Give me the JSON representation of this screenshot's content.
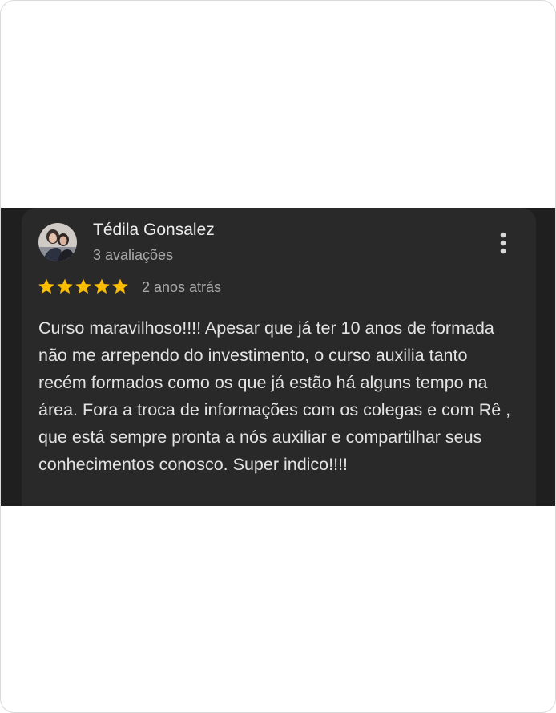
{
  "review": {
    "author": "Tédila Gonsalez",
    "review_count": "3 avaliações",
    "rating": 5,
    "rating_max": 5,
    "time": "2 anos atrás",
    "text": "Curso maravilhoso!!!! Apesar que já ter 10 anos de formada não me arrependo do investimento, o curso auxilia tanto recém formados como os que já estão há alguns tempo na área. Fora a troca de informações com os colegas e com Rê , que está sempre pronta a nós auxiliar e compartilhar seus conhecimentos conosco. Super indico!!!!"
  },
  "colors": {
    "star": "#fbbc04",
    "card_background": "#292929",
    "band_background": "#1f1f1f"
  },
  "icons": {
    "more": "more-vert-icon",
    "star": "star-icon"
  }
}
